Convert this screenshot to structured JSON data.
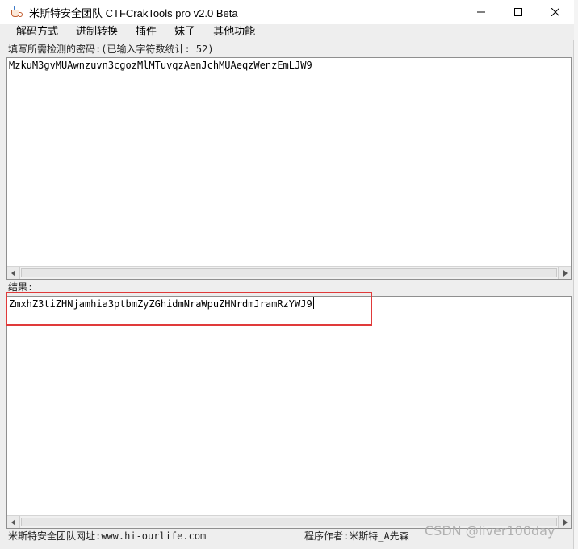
{
  "window": {
    "title": "米斯特安全团队 CTFCrakTools pro v2.0 Beta"
  },
  "menu": {
    "items": [
      "解码方式",
      "进制转换",
      "插件",
      "妹子",
      "其他功能"
    ]
  },
  "input_section": {
    "label": "填写所需检测的密码:(已输入字符数统计: 52)",
    "value": "MzkuM3gvMUAwnzuvn3cgozMlMTuvqzAenJchMUAeqzWenzEmLJW9"
  },
  "result_section": {
    "label": "结果:",
    "value": "ZmxhZ3tiZHNjamhia3ptbmZyZGhidmNraWpuZHNrdmJramRzYWJ9"
  },
  "status_bar": {
    "left_text": "米斯特安全团队网址:www.hi-ourlife.com",
    "right_text": "程序作者:米斯特_A先森"
  },
  "watermark": {
    "text": "CSDN @liver100day"
  },
  "colors": {
    "highlight": "#e03a3a",
    "panel_border": "#8f8f8f",
    "window_bg": "#eeeeee"
  }
}
